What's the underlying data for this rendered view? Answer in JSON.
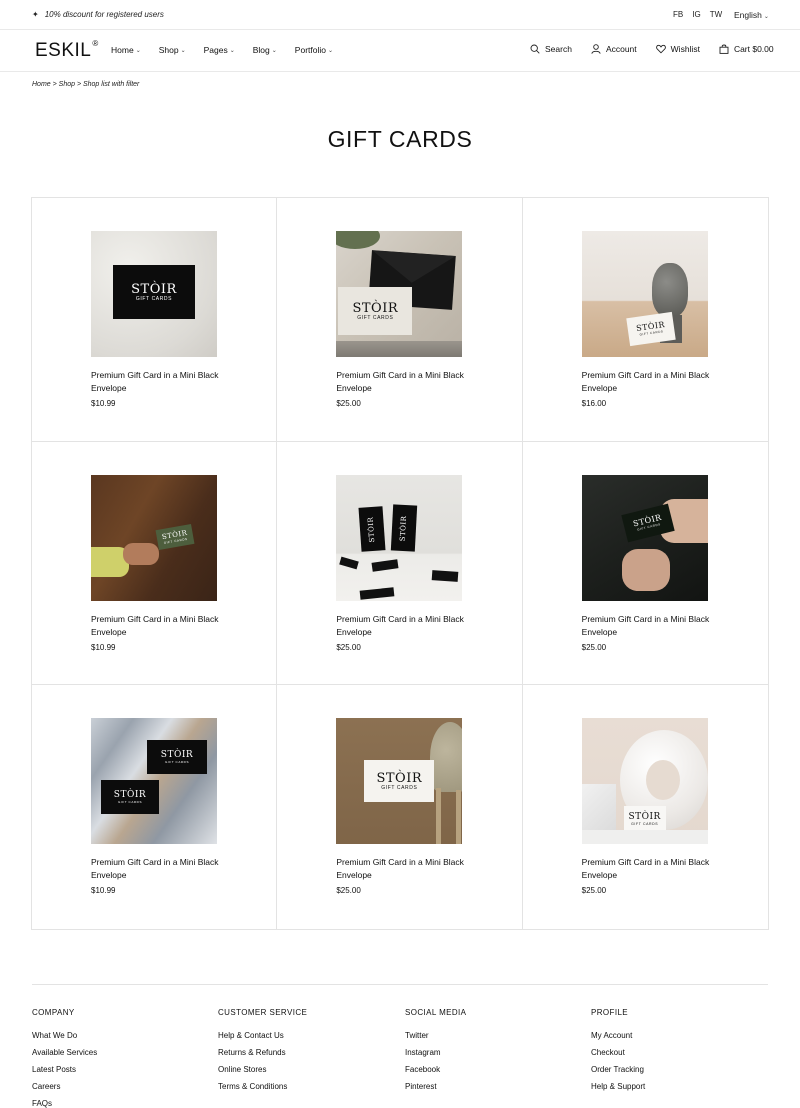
{
  "topbar": {
    "promo": "10% discount for registered users",
    "social": [
      "FB",
      "IG",
      "TW"
    ],
    "language": "English"
  },
  "header": {
    "logo": "ESKIL",
    "logo_mark": "®",
    "nav": [
      "Home",
      "Shop",
      "Pages",
      "Blog",
      "Portfolio"
    ],
    "search": "Search",
    "account": "Account",
    "wishlist": "Wishlist",
    "cart": "Cart $0.00"
  },
  "breadcrumb": "Home > Shop > Shop list with filter",
  "page_title": "GIFT CARDS",
  "card_brand": "STÒIR",
  "card_sub": "GIFT CARDS",
  "products": [
    {
      "name": "Premium Gift Card in a Mini Black Envelope",
      "price": "$10.99"
    },
    {
      "name": "Premium Gift Card in a Mini Black Envelope",
      "price": "$25.00"
    },
    {
      "name": "Premium Gift Card in a Mini Black Envelope",
      "price": "$16.00"
    },
    {
      "name": "Premium Gift Card in a Mini Black Envelope",
      "price": "$10.99"
    },
    {
      "name": "Premium Gift Card in a Mini Black Envelope",
      "price": "$25.00"
    },
    {
      "name": "Premium Gift Card in a Mini Black Envelope",
      "price": "$25.00"
    },
    {
      "name": "Premium Gift Card in a Mini Black Envelope",
      "price": "$10.99"
    },
    {
      "name": "Premium Gift Card in a Mini Black Envelope",
      "price": "$25.00"
    },
    {
      "name": "Premium Gift Card in a Mini Black Envelope",
      "price": "$25.00"
    }
  ],
  "footer": {
    "company": {
      "title": "COMPANY",
      "links": [
        "What We Do",
        "Available Services",
        "Latest Posts",
        "Careers",
        "FAQs"
      ]
    },
    "service": {
      "title": "CUSTOMER SERVICE",
      "links": [
        "Help & Contact Us",
        "Returns & Refunds",
        "Online Stores",
        "Terms & Conditions"
      ]
    },
    "social": {
      "title": "SOCIAL MEDIA",
      "links": [
        "Twitter",
        "Instagram",
        "Facebook",
        "Pinterest"
      ]
    },
    "profile": {
      "title": "PROFILE",
      "links": [
        "My Account",
        "Checkout",
        "Order Tracking",
        "Help & Support"
      ]
    }
  }
}
